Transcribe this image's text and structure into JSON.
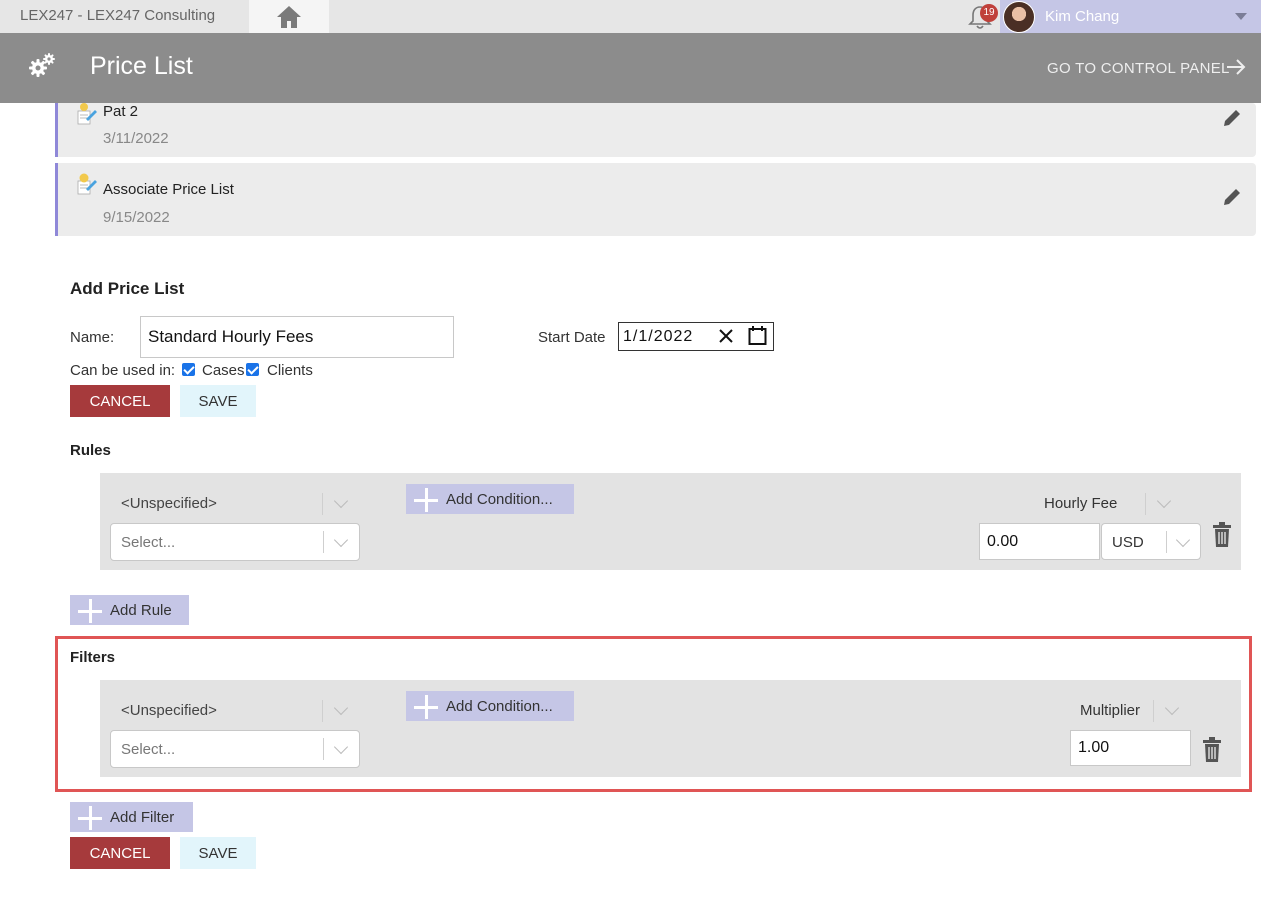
{
  "topbar": {
    "brand": "LEX247   -  LEX247 Consulting",
    "notifications_count": "19",
    "user_name": "Kim Chang"
  },
  "header": {
    "title": "Price List",
    "control_panel_link": "GO TO CONTROL PANEL"
  },
  "price_lists": [
    {
      "name": "Pat 2",
      "date": "3/11/2022"
    },
    {
      "name": "Associate Price List",
      "date": "9/15/2022"
    }
  ],
  "form": {
    "heading": "Add Price List",
    "name_label": "Name:",
    "name_value": "Standard Hourly Fees",
    "start_date_label": "Start Date",
    "start_date_value": "1/1/2022",
    "usage_label": "Can be used in:",
    "usage_cases": "Cases",
    "usage_clients": "Clients",
    "cases_checked": true,
    "clients_checked": true,
    "cancel_label": "CANCEL",
    "save_label": "SAVE"
  },
  "rules": {
    "heading": "Rules",
    "unspecified": "<Unspecified>",
    "select_placeholder": "Select...",
    "add_condition_label": "Add Condition...",
    "fee_type": "Hourly Fee",
    "fee_value": "0.00",
    "currency": "USD",
    "add_rule_label": "Add Rule"
  },
  "filters": {
    "heading": "Filters",
    "unspecified": "<Unspecified>",
    "select_placeholder": "Select...",
    "add_condition_label": "Add Condition...",
    "value_type": "Multiplier",
    "value": "1.00",
    "add_filter_label": "Add Filter"
  },
  "bottom_actions": {
    "cancel_label": "CANCEL",
    "save_label": "SAVE"
  },
  "colors": {
    "header_bg": "#8c8c8c",
    "accent_purple": "#c5c6e6",
    "cancel_red": "#a63a3c",
    "save_light": "#e2f5fb",
    "highlight_red": "#e05555"
  }
}
